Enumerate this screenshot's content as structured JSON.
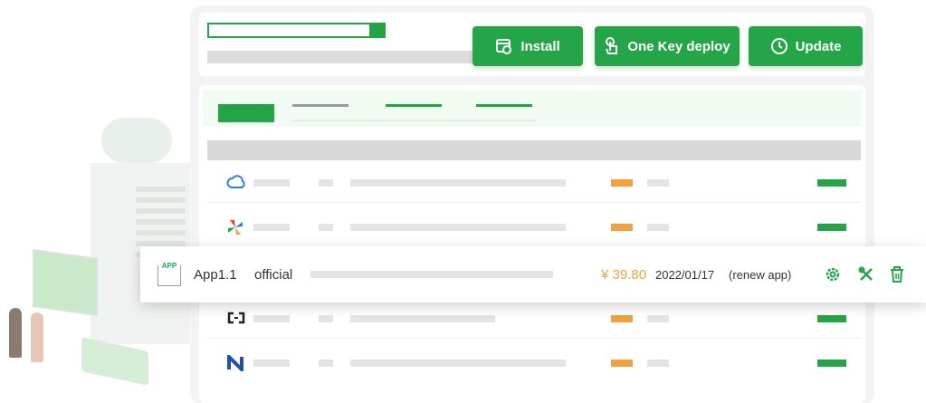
{
  "toolbar": {
    "install_label": "Install",
    "one_key_deploy_label": "One Key deploy",
    "update_label": "Update"
  },
  "app_row": {
    "icon_text": "APP",
    "name": "App1.1",
    "source": "official",
    "price": "¥ 39.80",
    "date": "2022/01/17",
    "renew": "(renew app)"
  },
  "colors": {
    "accent": "#22a447",
    "price": "#f0a33c"
  },
  "icons": [
    "install-icon",
    "touch-icon",
    "update-icon",
    "settings-icon",
    "tools-icon",
    "trash-icon",
    "cloud-icon",
    "pinwheel-icon",
    "bracket-icon",
    "n-logo-icon"
  ]
}
